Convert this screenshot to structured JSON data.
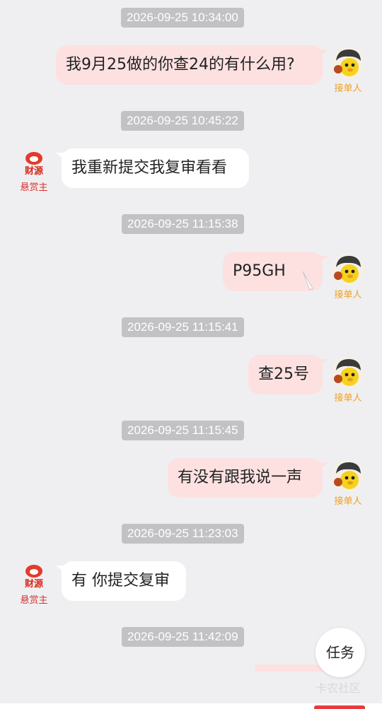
{
  "roles": {
    "taker": "接单人",
    "poster": "悬赏主"
  },
  "messages": [
    {
      "time": "2026-09-25 10:34:00",
      "side": "out",
      "text": "我9月25做的你查24的有什么用?"
    },
    {
      "time": "2026-09-25 10:45:22",
      "side": "in",
      "text": "我重新提交我复审看看"
    },
    {
      "time": "2026-09-25 11:15:38",
      "side": "out",
      "text": "P95GH"
    },
    {
      "time": "2026-09-25 11:15:41",
      "side": "out",
      "text": "查25号"
    },
    {
      "time": "2026-09-25 11:15:45",
      "side": "out",
      "text": "有没有跟我说一声"
    },
    {
      "time": "2026-09-25 11:23:03",
      "side": "in",
      "text": "有 你提交复审"
    },
    {
      "time": "2026-09-25 11:42:09"
    }
  ],
  "task_button": "任务",
  "watermark": "卡农社区",
  "colors": {
    "outgoing_bubble": "#fde1e1",
    "incoming_bubble": "#ffffff",
    "timestamp_bg": "#c2c2c4",
    "taker_label": "#f0a020",
    "poster_label": "#d83030"
  }
}
